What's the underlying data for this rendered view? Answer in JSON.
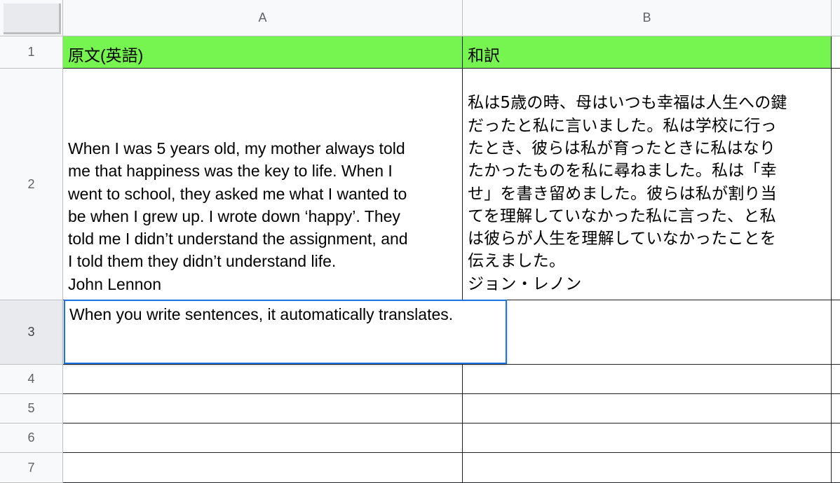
{
  "columns": [
    {
      "label": "A"
    },
    {
      "label": "B"
    }
  ],
  "rows": [
    {
      "number": "1",
      "cells": [
        "原文(英語)",
        "和訳"
      ]
    },
    {
      "number": "2",
      "cells": [
        "When I was 5 years old, my mother always told\nme that happiness was the key to life. When I\nwent to school, they asked me what I wanted to\nbe when I grew up. I wrote down ‘happy’. They\ntold me I didn’t understand the assignment, and\nI told them they didn’t understand life.\nJohn Lennon",
        "私は5歳の時、母はいつも幸福は人生への鍵\nだったと私に言いました。私は学校に行っ\nたとき、彼らは私が育ったときに私はなり\nたかったものを私に尋ねました。私は「幸\nせ」を書き留めました。彼らは私が割り当\nてを理解していなかった私に言った、と私\nは彼らが人生を理解していなかったことを\n伝えました。\nジョン・レノン"
      ]
    },
    {
      "number": "3",
      "cells": [
        "When you write sentences, it automatically translates.",
        ""
      ]
    },
    {
      "number": "4",
      "cells": [
        "",
        ""
      ]
    },
    {
      "number": "5",
      "cells": [
        "",
        ""
      ]
    },
    {
      "number": "6",
      "cells": [
        "",
        ""
      ]
    },
    {
      "number": "7",
      "cells": [
        "",
        ""
      ]
    }
  ],
  "active_cell": {
    "row": "3",
    "column": "A",
    "editing_value": "When you write sentences, it automatically translates."
  },
  "colors": {
    "header_fill": "#76f551",
    "selection_border": "#1a73e8",
    "header_background": "#f8f9fa"
  }
}
